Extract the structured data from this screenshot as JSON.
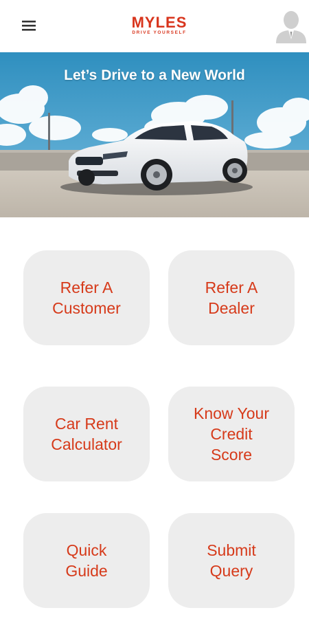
{
  "header": {
    "logo_text": "MYLES",
    "logo_tagline": "DRIVE YOURSELF",
    "menu_icon": "hamburger-menu-icon",
    "avatar_icon": "user-avatar-icon"
  },
  "banner": {
    "title": "Let’s Drive to a New World"
  },
  "actions": [
    {
      "label": "Refer A\nCustomer"
    },
    {
      "label": "Refer A\nDealer"
    },
    {
      "label": "Car Rent\nCalculator"
    },
    {
      "label": "Know Your\nCredit\nScore"
    },
    {
      "label": "Quick\nGuide"
    },
    {
      "label": "Submit\nQuery"
    }
  ],
  "colors": {
    "brand": "#d8341c",
    "button_bg": "#ededed",
    "button_text": "#d63a1a"
  }
}
